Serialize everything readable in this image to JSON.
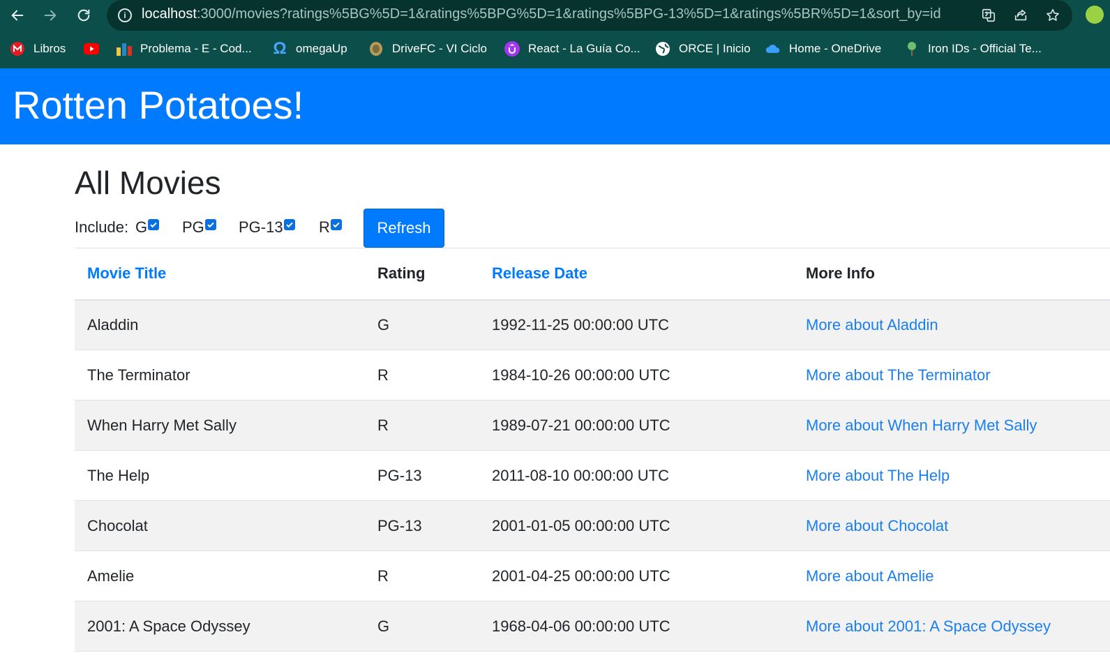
{
  "browser": {
    "url_host": "localhost",
    "url_rest": ":3000/movies?ratings%5BG%5D=1&ratings%5BPG%5D=1&ratings%5BPG-13%5D=1&ratings%5BR%5D=1&sort_by=id",
    "bookmarks": [
      {
        "label": "Libros",
        "icon": "m-icon",
        "color": "#e51c23"
      },
      {
        "label": "",
        "icon": "youtube-icon",
        "color": "#ff0000"
      },
      {
        "label": "Problema - E - Cod...",
        "icon": "codeforces-icon",
        "color": "#f6c43d"
      },
      {
        "label": "omegaUp",
        "icon": "omega-icon",
        "color": "#4aa3ff"
      },
      {
        "label": "DriveFC - VI Ciclo",
        "icon": "shield-icon",
        "color": "#b59a5a"
      },
      {
        "label": "React - La Guía Co...",
        "icon": "udemy-icon",
        "color": "#a435f0"
      },
      {
        "label": "ORCE | Inicio",
        "icon": "globe-icon",
        "color": "#ffffff"
      },
      {
        "label": "Home - OneDrive",
        "icon": "cloud-icon",
        "color": "#3aa0ff"
      },
      {
        "label": "Iron IDs - Official Te...",
        "icon": "tree-icon",
        "color": "#6fbf73"
      }
    ]
  },
  "site": {
    "title": "Rotten Potatoes!"
  },
  "page": {
    "title": "All Movies",
    "include_label": "Include: ",
    "ratings": [
      {
        "label": "G",
        "checked": true
      },
      {
        "label": "PG",
        "checked": true
      },
      {
        "label": "PG-13",
        "checked": true
      },
      {
        "label": "R",
        "checked": true
      }
    ],
    "refresh_label": "Refresh"
  },
  "table": {
    "headers": {
      "title": "Movie Title",
      "rating": "Rating",
      "release": "Release Date",
      "more": "More Info"
    },
    "rows": [
      {
        "title": "Aladdin",
        "rating": "G",
        "release": "1992-11-25 00:00:00 UTC",
        "more": "More about Aladdin"
      },
      {
        "title": "The Terminator",
        "rating": "R",
        "release": "1984-10-26 00:00:00 UTC",
        "more": "More about The Terminator"
      },
      {
        "title": "When Harry Met Sally",
        "rating": "R",
        "release": "1989-07-21 00:00:00 UTC",
        "more": "More about When Harry Met Sally"
      },
      {
        "title": "The Help",
        "rating": "PG-13",
        "release": "2011-08-10 00:00:00 UTC",
        "more": "More about The Help"
      },
      {
        "title": "Chocolat",
        "rating": "PG-13",
        "release": "2001-01-05 00:00:00 UTC",
        "more": "More about Chocolat"
      },
      {
        "title": "Amelie",
        "rating": "R",
        "release": "2001-04-25 00:00:00 UTC",
        "more": "More about Amelie"
      },
      {
        "title": "2001: A Space Odyssey",
        "rating": "G",
        "release": "1968-04-06 00:00:00 UTC",
        "more": "More about 2001: A Space Odyssey"
      }
    ]
  },
  "colors": {
    "chrome": "#0c4f4a",
    "header": "#007bff",
    "link": "#007bff",
    "stripe": "#f2f2f2"
  }
}
